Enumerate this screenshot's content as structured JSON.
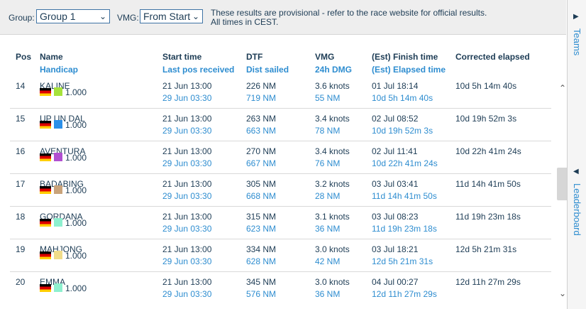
{
  "filters": {
    "group_label": "Group:",
    "group_value": "Group 1",
    "vmg_label": "VMG:",
    "vmg_value": "From Start",
    "notice_line1": "These results are provisional - refer to the race website for official results.",
    "notice_line2": "All times in CEST."
  },
  "headers": {
    "pos": "Pos",
    "name": "Name",
    "handicap": "Handicap",
    "start": "Start time",
    "last_pos": "Last pos received",
    "dtf": "DTF",
    "dist": "Dist sailed",
    "vmg": "VMG",
    "dmg": "24h DMG",
    "finish": "(Est) Finish time",
    "elapsed": "(Est) Elapsed time",
    "corrected": "Corrected elapsed"
  },
  "rows": [
    {
      "pos": "14",
      "name": "KALINE",
      "handicap": "1.000",
      "color": "#a6e23a",
      "start": "21 Jun 13:00",
      "last": "29 Jun 03:30",
      "dtf": "226 NM",
      "dist": "719 NM",
      "vmg": "3.6 knots",
      "dmg": "55 NM",
      "finish": "01 Jul 18:14",
      "elapsed": "10d 5h 14m 40s",
      "corrected": "10d 5h 14m 40s"
    },
    {
      "pos": "15",
      "name": "UP UN DAL",
      "handicap": "1.000",
      "color": "#2b8fe8",
      "start": "21 Jun 13:00",
      "last": "29 Jun 03:30",
      "dtf": "263 NM",
      "dist": "663 NM",
      "vmg": "3.4 knots",
      "dmg": "78 NM",
      "finish": "02 Jul 08:52",
      "elapsed": "10d 19h 52m 3s",
      "corrected": "10d 19h 52m 3s"
    },
    {
      "pos": "16",
      "name": "AVENTURA",
      "handicap": "1.000",
      "color": "#b14fd1",
      "start": "21 Jun 13:00",
      "last": "29 Jun 03:30",
      "dtf": "270 NM",
      "dist": "667 NM",
      "vmg": "3.4 knots",
      "dmg": "76 NM",
      "finish": "02 Jul 11:41",
      "elapsed": "10d 22h 41m 24s",
      "corrected": "10d 22h 41m 24s"
    },
    {
      "pos": "17",
      "name": "BADABING",
      "handicap": "1.000",
      "color": "#c9a37a",
      "start": "21 Jun 13:00",
      "last": "29 Jun 03:30",
      "dtf": "305 NM",
      "dist": "668 NM",
      "vmg": "3.2 knots",
      "dmg": "28 NM",
      "finish": "03 Jul 03:41",
      "elapsed": "11d 14h 41m 50s",
      "corrected": "11d 14h 41m 50s"
    },
    {
      "pos": "18",
      "name": "GORDANA",
      "handicap": "1.000",
      "color": "#8ef0cf",
      "start": "21 Jun 13:00",
      "last": "29 Jun 03:30",
      "dtf": "315 NM",
      "dist": "623 NM",
      "vmg": "3.1 knots",
      "dmg": "36 NM",
      "finish": "03 Jul 08:23",
      "elapsed": "11d 19h 23m 18s",
      "corrected": "11d 19h 23m 18s"
    },
    {
      "pos": "19",
      "name": "MAHJONG",
      "handicap": "1.000",
      "color": "#f0dc8a",
      "start": "21 Jun 13:00",
      "last": "29 Jun 03:30",
      "dtf": "334 NM",
      "dist": "628 NM",
      "vmg": "3.0 knots",
      "dmg": "42 NM",
      "finish": "03 Jul 18:21",
      "elapsed": "12d 5h 21m 31s",
      "corrected": "12d 5h 21m 31s"
    },
    {
      "pos": "20",
      "name": "EMMA",
      "handicap": "1.000",
      "color": "#8ef0cf",
      "start": "21 Jun 13:00",
      "last": "29 Jun 03:30",
      "dtf": "345 NM",
      "dist": "576 NM",
      "vmg": "3.0 knots",
      "dmg": "36 NM",
      "finish": "04 Jul 00:27",
      "elapsed": "12d 11h 27m 29s",
      "corrected": "12d 11h 27m 29s"
    }
  ],
  "side": {
    "teams_label": "Teams",
    "leaderboard_label": "Leaderboard"
  },
  "icons": {
    "select_chevron": "chevron-down-icon",
    "scroll_up": "chevron-up-icon",
    "scroll_down": "chevron-down-icon",
    "teams_toggle": "triangle-right-icon",
    "leaderboard_toggle": "triangle-left-icon",
    "flag": "germany-flag-icon"
  },
  "colors": {
    "text": "#1d3c55",
    "link": "#2e8dd0",
    "select_border": "#3f74a5"
  }
}
